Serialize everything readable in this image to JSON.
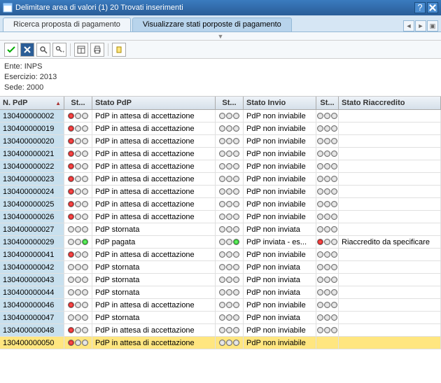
{
  "window": {
    "title": "Delimitare area di valori (1)   20 Trovati inserimenti"
  },
  "tabs": {
    "t1": "Ricerca proposta di pagamento",
    "t2": "Visualizzare stati porposte di pagamento"
  },
  "info": {
    "ente_label": "Ente:",
    "ente_value": "INPS",
    "esercizio_label": "Esercizio:",
    "esercizio_value": "2013",
    "sede_label": "Sede:",
    "sede_value": "2000"
  },
  "headers": {
    "c0": "N. PdP",
    "c1": "St...",
    "c2": "Stato PdP",
    "c3": "St...",
    "c4": "Stato Invio",
    "c5": "St...",
    "c6": "Stato Riaccredito"
  },
  "rows": [
    {
      "n": "130400000002",
      "l1": "roo",
      "stpdp": "PdP in attesa di accettazione",
      "l2": "ooo",
      "stinv": "PdP non inviabile",
      "l3": "ooo",
      "str": ""
    },
    {
      "n": "130400000019",
      "l1": "roo",
      "stpdp": "PdP in attesa di accettazione",
      "l2": "ooo",
      "stinv": "PdP non inviabile",
      "l3": "ooo",
      "str": ""
    },
    {
      "n": "130400000020",
      "l1": "roo",
      "stpdp": "PdP in attesa di accettazione",
      "l2": "ooo",
      "stinv": "PdP non inviabile",
      "l3": "ooo",
      "str": ""
    },
    {
      "n": "130400000021",
      "l1": "roo",
      "stpdp": "PdP in attesa di accettazione",
      "l2": "ooo",
      "stinv": "PdP non inviabile",
      "l3": "ooo",
      "str": ""
    },
    {
      "n": "130400000022",
      "l1": "roo",
      "stpdp": "PdP in attesa di accettazione",
      "l2": "ooo",
      "stinv": "PdP non inviabile",
      "l3": "ooo",
      "str": ""
    },
    {
      "n": "130400000023",
      "l1": "roo",
      "stpdp": "PdP in attesa di accettazione",
      "l2": "ooo",
      "stinv": "PdP non inviabile",
      "l3": "ooo",
      "str": ""
    },
    {
      "n": "130400000024",
      "l1": "roo",
      "stpdp": "PdP in attesa di accettazione",
      "l2": "ooo",
      "stinv": "PdP non inviabile",
      "l3": "ooo",
      "str": ""
    },
    {
      "n": "130400000025",
      "l1": "roo",
      "stpdp": "PdP in attesa di accettazione",
      "l2": "ooo",
      "stinv": "PdP non inviabile",
      "l3": "ooo",
      "str": ""
    },
    {
      "n": "130400000026",
      "l1": "roo",
      "stpdp": "PdP in attesa di accettazione",
      "l2": "ooo",
      "stinv": "PdP non inviabile",
      "l3": "ooo",
      "str": ""
    },
    {
      "n": "130400000027",
      "l1": "ooo",
      "stpdp": "PdP stornata",
      "l2": "ooo",
      "stinv": "PdP non inviata",
      "l3": "ooo",
      "str": ""
    },
    {
      "n": "130400000029",
      "l1": "oog",
      "stpdp": "PdP pagata",
      "l2": "oog",
      "stinv": "PdP inviata - es...",
      "l3": "roo",
      "str": "Riaccredito da specificare"
    },
    {
      "n": "130400000041",
      "l1": "roo",
      "stpdp": "PdP in attesa di accettazione",
      "l2": "ooo",
      "stinv": "PdP non inviabile",
      "l3": "ooo",
      "str": ""
    },
    {
      "n": "130400000042",
      "l1": "ooo",
      "stpdp": "PdP stornata",
      "l2": "ooo",
      "stinv": "PdP non inviata",
      "l3": "ooo",
      "str": ""
    },
    {
      "n": "130400000043",
      "l1": "ooo",
      "stpdp": "PdP stornata",
      "l2": "ooo",
      "stinv": "PdP non inviata",
      "l3": "ooo",
      "str": ""
    },
    {
      "n": "130400000044",
      "l1": "ooo",
      "stpdp": "PdP stornata",
      "l2": "ooo",
      "stinv": "PdP non inviata",
      "l3": "ooo",
      "str": ""
    },
    {
      "n": "130400000046",
      "l1": "roo",
      "stpdp": "PdP in attesa di accettazione",
      "l2": "ooo",
      "stinv": "PdP non inviabile",
      "l3": "ooo",
      "str": ""
    },
    {
      "n": "130400000047",
      "l1": "ooo",
      "stpdp": "PdP stornata",
      "l2": "ooo",
      "stinv": "PdP non inviata",
      "l3": "ooo",
      "str": ""
    },
    {
      "n": "130400000048",
      "l1": "roo",
      "stpdp": "PdP in attesa di accettazione",
      "l2": "ooo",
      "stinv": "PdP non inviabile",
      "l3": "ooo",
      "str": ""
    },
    {
      "n": "130400000050",
      "l1": "roo",
      "stpdp": "PdP in attesa di accettazione",
      "l2": "ooo",
      "stinv": "PdP non inviabile",
      "l3": "",
      "str": "",
      "sel": true
    }
  ]
}
